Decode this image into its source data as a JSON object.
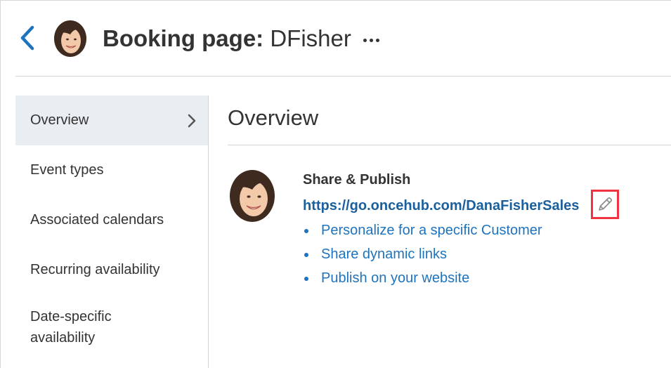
{
  "header": {
    "title_prefix": "Booking page:",
    "title_name": "DFisher"
  },
  "sidebar": {
    "items": [
      {
        "label": "Overview",
        "active": true
      },
      {
        "label": "Event types"
      },
      {
        "label": "Associated calendars"
      },
      {
        "label": "Recurring availability"
      },
      {
        "label": "Date-specific availability"
      }
    ]
  },
  "main": {
    "title": "Overview",
    "share": {
      "heading": "Share & Publish",
      "url": "https://go.oncehub.com/DanaFisherSales",
      "links": [
        "Personalize for a specific Customer",
        "Share dynamic links",
        "Publish on your website"
      ]
    }
  },
  "icons": {
    "back": "chevron-left-icon",
    "more": "more-horizontal-icon",
    "sidebar_arrow": "chevron-right-icon",
    "edit": "pencil-icon"
  },
  "colors": {
    "accent": "#1e73be",
    "url": "#1a5f9e",
    "active_nav_bg": "#e9eef3",
    "highlight_border": "#ef3340"
  }
}
